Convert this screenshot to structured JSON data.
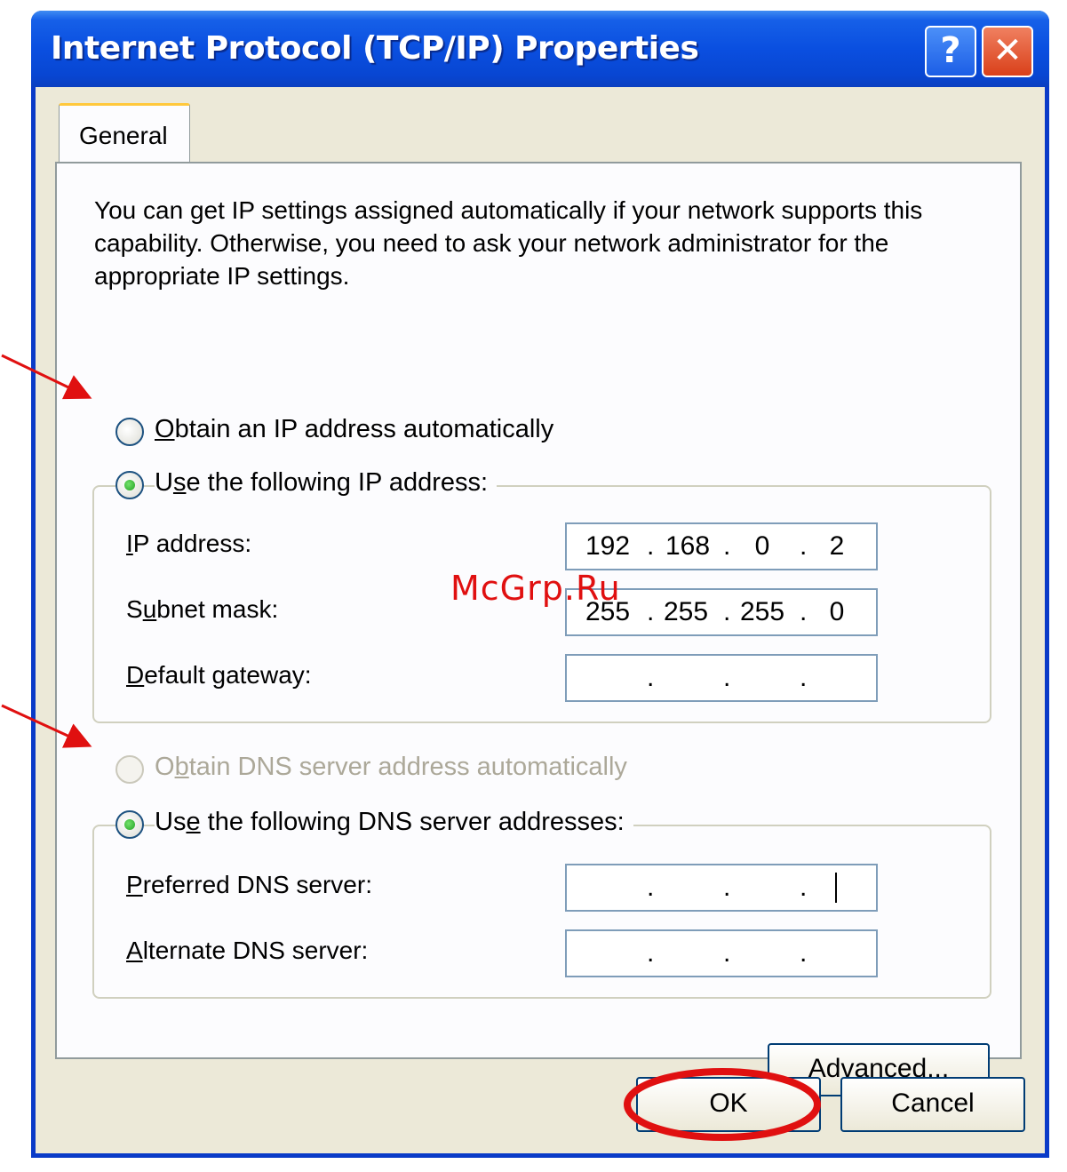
{
  "window": {
    "title": "Internet Protocol (TCP/IP) Properties",
    "help_glyph": "?",
    "close_glyph": "✕"
  },
  "tabs": [
    {
      "label": "General",
      "active": true
    }
  ],
  "intro_text": "You can get IP settings assigned automatically if your network supports this capability. Otherwise, you need to ask your network administrator for the appropriate IP settings.",
  "ip_section": {
    "auto": {
      "prefix": "",
      "accel": "O",
      "rest": "btain an IP address automatically",
      "checked": false
    },
    "manual": {
      "prefix": "U",
      "accel": "s",
      "rest": "e the following IP address:",
      "checked": true
    },
    "fields": {
      "ip": {
        "accel": "I",
        "rest": "P address:",
        "octets": [
          "192",
          "168",
          "0",
          "2"
        ]
      },
      "subnet": {
        "pre": "S",
        "accel": "u",
        "rest": "bnet mask:",
        "octets": [
          "255",
          "255",
          "255",
          "0"
        ]
      },
      "gateway": {
        "accel": "D",
        "rest": "efault gateway:",
        "octets": [
          "",
          "",
          "",
          ""
        ]
      }
    }
  },
  "dns_section": {
    "auto": {
      "pre": "O",
      "accel": "b",
      "rest": "tain DNS server address automatically",
      "checked": false,
      "disabled": true
    },
    "manual": {
      "pre": "Us",
      "accel": "e",
      "rest": " the following DNS server addresses:",
      "checked": true
    },
    "fields": {
      "preferred": {
        "accel": "P",
        "rest": "referred DNS server:",
        "octets": [
          "",
          "",
          "",
          ""
        ]
      },
      "alternate": {
        "accel": "A",
        "rest": "lternate DNS server:",
        "octets": [
          "",
          "",
          "",
          ""
        ]
      }
    }
  },
  "buttons": {
    "advanced": {
      "pre": "Ad",
      "accel": "v",
      "rest": "anced..."
    },
    "ok": "OK",
    "cancel": "Cancel"
  },
  "annotations": {
    "watermark": "McGrp.Ru",
    "arrow_color": "#e01010",
    "highlight_color": "#e01010"
  },
  "colors": {
    "titlebar": "#0a4fe0",
    "dialog_bg": "#ece9d8",
    "radio_dot": "#21a121",
    "field_border": "#7f9db9"
  }
}
